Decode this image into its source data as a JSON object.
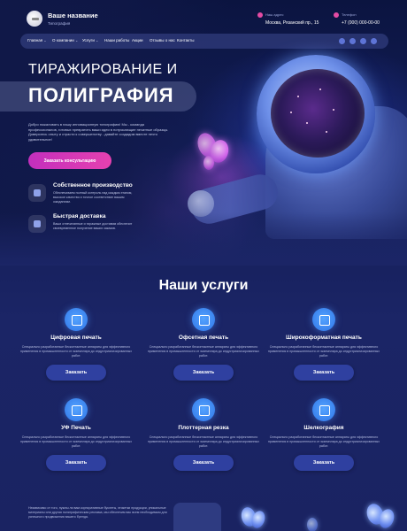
{
  "header": {
    "brand_name": "Ваше название",
    "brand_sub": "Типография",
    "address_label": "Наш адрес",
    "address": "Москва, Рязанский пр., 15",
    "phone_label": "Телефон",
    "phone": "+7 (000) 000-00-00"
  },
  "nav": {
    "items": [
      "Главная",
      "О компании",
      "Услуги",
      "Наши работы",
      "Акции",
      "Отзывы о нас",
      "Контакты"
    ],
    "dropdown_items": [
      "Главная",
      "О компании",
      "Услуги"
    ]
  },
  "hero": {
    "title_line1": "ТИРАЖИРОВАНИЕ И",
    "title_line2": "ПОЛИГРАФИЯ",
    "description": "Добро пожаловать в нашу инновационную типографию! Мы - команда профессионалов, готовых превратить ваши идеи в потрясающие печатные образцы. Доверьтесь опыту и страсти к совершенству - давайте создадим вместе нечто удивительное!",
    "cta_label": "Заказать консультацию",
    "features": [
      {
        "title": "Собственное производство",
        "text": "Обеспечиваем полный контроль над каждым этапом, высокое качество и точное соответствие вашим ожиданиям."
      },
      {
        "title": "Быстрая доставка",
        "text": "Ваши отпечатанные и тиражные доставим обеспечит своевременное получение ваших заказов."
      }
    ]
  },
  "services": {
    "title": "Наши услуги",
    "items": [
      {
        "title": "Цифровая печать",
        "text": "Специально разработанные бесконтактные аппараты для эффективного применения в промышленности от экземпляра до индустриализированных работ.",
        "button": "Заказать"
      },
      {
        "title": "Офсетная печать",
        "text": "Специально разработанные бесконтактные аппараты для эффективного применения в промышленности от экземпляра до индустриализированных работ.",
        "button": "Заказать"
      },
      {
        "title": "Широкоформатная печать",
        "text": "Специально разработанные бесконтактные аппараты для эффективного применения в промышленности от экземпляра до индустриализированных работ.",
        "button": "Заказать"
      },
      {
        "title": "УФ Печать",
        "text": "Специально разработанные бесконтактные аппараты для эффективного применения в промышленности от экземпляра до индустриализированных работ.",
        "button": "Заказать"
      },
      {
        "title": "Плоттерная резка",
        "text": "Специально разработанные бесконтактные аппараты для эффективного применения в промышленности от экземпляра до индустриализированных работ.",
        "button": "Заказать"
      },
      {
        "title": "Шелкография",
        "text": "Специально разработанные бесконтактные аппараты для эффективного применения в промышленности от экземпляра до индустриализированных работ.",
        "button": "Заказать"
      }
    ]
  },
  "footer_teaser": {
    "text": "Независимо от того, нужны ли вам корпоративные буклеты, этикетки продукции, уникальные материалы или другая полиграфическая реклама, мы обеспечим вас всем необходимым для успешного продвижения вашего бренда."
  },
  "colors": {
    "accent": "#e641b0",
    "primary_button": "#2f40a0",
    "background": "#1b2566",
    "icon_blue": "#3a85f0"
  }
}
